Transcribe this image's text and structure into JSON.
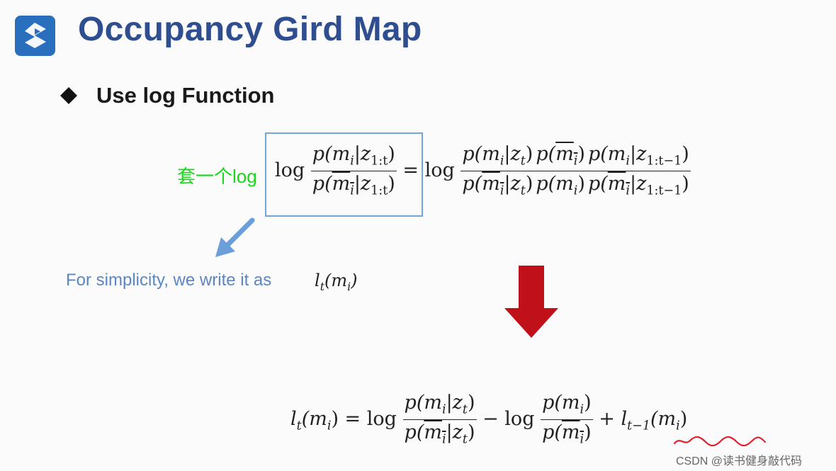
{
  "slide": {
    "title": "Occupancy Gird Map",
    "bullet": "Use log Function",
    "annotation": "套一个log",
    "note": "For simplicity, we write it as",
    "note_symbol": "l",
    "note_symbol_sub": "t",
    "note_symbol_arg": "(m",
    "note_symbol_arg_sub": "i",
    "note_symbol_close": ")",
    "watermark": "CSDN @读书健身敲代码"
  },
  "eq1": {
    "log1": "log",
    "lhs_num_a": "p(m",
    "lhs_num_b": "i",
    "lhs_num_c": "|z",
    "lhs_num_d": "1:t",
    "lhs_num_e": ")",
    "lhs_den_a": "p(",
    "lhs_den_ov": "m",
    "lhs_den_b": "i",
    "lhs_den_c": "|z",
    "lhs_den_d": "1:t",
    "lhs_den_e": ")",
    "eq": "= log",
    "f1_num_a": "p(m",
    "f1_num_b": "i",
    "f1_num_c": "|z",
    "f1_num_d": "t",
    "f1_num_e": ")",
    "f1_den_a": "p(",
    "f1_den_ov": "m",
    "f1_den_b": "i",
    "f1_den_c": "|z",
    "f1_den_d": "t",
    "f1_den_e": ")",
    "f2_num_a": "p(",
    "f2_num_ov": "m",
    "f2_num_b": "i",
    "f2_num_e": ")",
    "f2_den_a": "p(m",
    "f2_den_b": "i",
    "f2_den_e": ")",
    "f3_num_a": "p(m",
    "f3_num_b": "i",
    "f3_num_c": "|z",
    "f3_num_d": "1:t−1",
    "f3_num_e": ")",
    "f3_den_a": "p(",
    "f3_den_ov": "m",
    "f3_den_b": "i",
    "f3_den_c": "|z",
    "f3_den_d": "1:t−1",
    "f3_den_e": ")"
  },
  "eq2": {
    "lhs_a": "l",
    "lhs_b": "t",
    "lhs_c": "(m",
    "lhs_d": "i",
    "lhs_e": ") = log",
    "f1_num_a": "p(m",
    "f1_num_b": "i",
    "f1_num_c": "|z",
    "f1_num_d": "t",
    "f1_num_e": ")",
    "f1_den_a": "p(",
    "f1_den_ov": "m",
    "f1_den_b": "i",
    "f1_den_c": "|z",
    "f1_den_d": "t",
    "f1_den_e": ")",
    "minus": "− log",
    "f2_num_a": "p(m",
    "f2_num_b": "i",
    "f2_num_e": ")",
    "f2_den_a": "p(",
    "f2_den_ov": "m",
    "f2_den_b": "i",
    "f2_den_e": ")",
    "plus": "+",
    "tail_a": "l",
    "tail_b": "t−1",
    "tail_c": "(m",
    "tail_d": "i",
    "tail_e": ")"
  },
  "colors": {
    "title": "#2f4e8f",
    "logo": "#2a6fbd",
    "annotation": "#17d917",
    "note": "#5b86c4",
    "highlight_box": "#6fa8d8",
    "red_arrow": "#c0101a",
    "squiggle": "#e0202a"
  },
  "icons": [
    "logo-s-icon",
    "diamond-bullet-icon",
    "blue-arrow-icon",
    "red-down-arrow-icon",
    "red-squiggle-underline"
  ]
}
